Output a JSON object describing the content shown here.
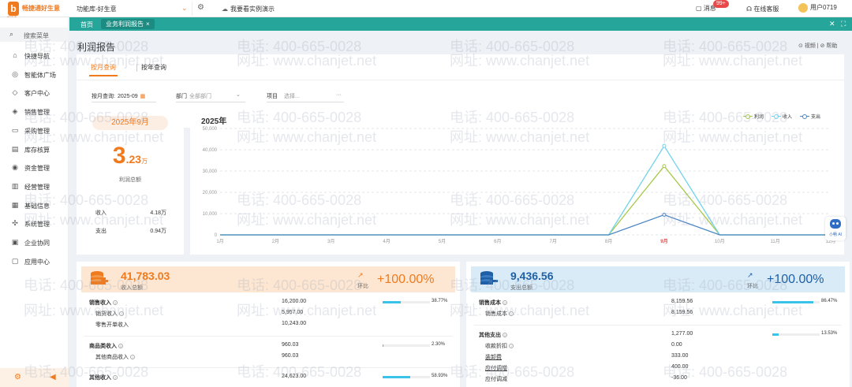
{
  "brand": {
    "name": "畅捷通好生意",
    "sub": "畅捷通"
  },
  "topbar": {
    "app_selector": "功能库-好生意",
    "demo_link": "我要看实例演示",
    "messages_label": "消息",
    "messages_badge": "99+",
    "service_label": "在线客服",
    "user_name": "用户0719"
  },
  "sidebar": {
    "search_placeholder": "搜索菜单",
    "items": [
      {
        "label": "快捷导航",
        "icon": "home-icon"
      },
      {
        "label": "智能体广场",
        "icon": "ai-icon"
      },
      {
        "label": "客户中心",
        "icon": "customer-icon"
      },
      {
        "label": "销售管理",
        "icon": "sales-icon"
      },
      {
        "label": "采购管理",
        "icon": "purchase-icon"
      },
      {
        "label": "库存核算",
        "icon": "inventory-icon"
      },
      {
        "label": "资金管理",
        "icon": "funds-icon"
      },
      {
        "label": "经营管理",
        "icon": "operation-icon"
      },
      {
        "label": "基础信息",
        "icon": "info-icon"
      },
      {
        "label": "系统管理",
        "icon": "system-icon"
      },
      {
        "label": "企业协同",
        "icon": "collab-icon"
      },
      {
        "label": "应用中心",
        "icon": "apps-icon"
      }
    ]
  },
  "tabs": {
    "home": "首页",
    "active": "业务利润报告"
  },
  "page": {
    "title": "利润报告",
    "help_video": "视频",
    "help_doc": "帮助",
    "subtabs": {
      "month": "按月查询",
      "year": "按年查询"
    },
    "filters": {
      "month_label": "按月查询:",
      "month_value": "2025-09",
      "dept_label": "部门",
      "dept_placeholder": "全部部门",
      "project_label": "项目",
      "project_placeholder": "选择...",
      "project_more": "···"
    }
  },
  "summary": {
    "month": "2025年9月",
    "profit_int": "3",
    "profit_dec": ".23",
    "profit_unit": "万",
    "profit_label": "利润总额",
    "income_label": "收入",
    "income_value": "4.18万",
    "expense_label": "支出",
    "expense_value": "0.94万"
  },
  "chart_data": {
    "type": "line",
    "title": "2025年",
    "categories": [
      "1月",
      "2月",
      "3月",
      "4月",
      "5月",
      "6月",
      "7月",
      "8月",
      "9月",
      "10月",
      "11月",
      "12月"
    ],
    "highlight_category": "9月",
    "ylim": [
      0,
      50000
    ],
    "yticks": [
      0,
      10000,
      20000,
      30000,
      40000,
      50000
    ],
    "ytick_labels": [
      "0",
      "10,000",
      "20,000",
      "30,000",
      "40,000",
      "50,000"
    ],
    "legend_position": "top-right",
    "series": [
      {
        "name": "利润",
        "color": "#a6c94a",
        "values": [
          0,
          0,
          0,
          0,
          0,
          0,
          0,
          0,
          32300,
          0,
          0,
          0
        ]
      },
      {
        "name": "收入",
        "color": "#6fd3ec",
        "values": [
          0,
          0,
          0,
          0,
          0,
          0,
          0,
          0,
          41783,
          0,
          0,
          0
        ]
      },
      {
        "name": "支出",
        "color": "#4a86c5",
        "values": [
          0,
          0,
          0,
          0,
          0,
          0,
          0,
          0,
          9437,
          0,
          0,
          0
        ]
      }
    ]
  },
  "income": {
    "amount": "41,783.03",
    "label": "收入总额",
    "trend_label": "环比",
    "trend_value": "+100.00%",
    "rows": [
      {
        "name": "销售收入",
        "value": "16,200.00",
        "pct": "38.77%",
        "ratio": 0.3877,
        "head": true
      },
      {
        "name": "销货收入",
        "value": "5,957.00",
        "sub": true,
        "info": true
      },
      {
        "name": "零售开单收入",
        "value": "10,243.00",
        "sub": true
      },
      {
        "name": "商品类收入",
        "value": "960.03",
        "pct": "2.30%",
        "ratio": 0.023,
        "head": true
      },
      {
        "name": "其他商品收入",
        "value": "960.03",
        "sub": true,
        "info": true
      },
      {
        "name": "其他收入",
        "value": "24,623.00",
        "pct": "58.93%",
        "ratio": 0.5893,
        "head": true
      }
    ]
  },
  "expense": {
    "amount": "9,436.56",
    "label": "支出总额",
    "trend_label": "环比",
    "trend_value": "+100.00%",
    "rows": [
      {
        "name": "销售成本",
        "value": "8,159.56",
        "pct": "86.47%",
        "ratio": 0.8647,
        "head": true
      },
      {
        "name": "销售成本",
        "value": "8,159.56",
        "sub": true,
        "info": true
      },
      {
        "name": "其他支出",
        "value": "1,277.00",
        "pct": "13.53%",
        "ratio": 0.1353,
        "head": true
      },
      {
        "name": "收款折扣",
        "value": "0.00",
        "sub": true,
        "info": true
      },
      {
        "name": "装卸费",
        "value": "333.00",
        "sub": true,
        "ul": true
      },
      {
        "name": "应付调增",
        "value": "400.00",
        "sub": true,
        "ul": true
      },
      {
        "name": "应付调减",
        "value": "-36.00",
        "sub": true
      }
    ]
  },
  "robot_label": "小畅 AI",
  "watermark": {
    "phone": "电话: 400-665-0028",
    "site": "网址: www.chanjet.net"
  }
}
